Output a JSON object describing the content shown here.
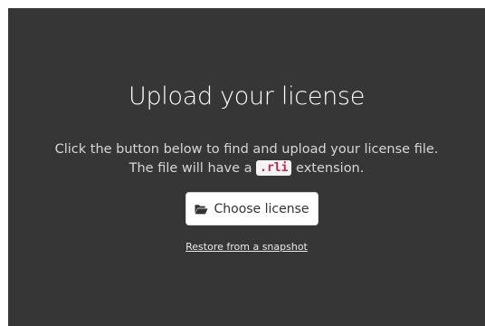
{
  "upload": {
    "title": "Upload your license",
    "description_line1": "Click the button below to find and upload your license file.",
    "description_line2_prefix": "The file will have a ",
    "extension": ".rli",
    "description_line2_suffix": " extension.",
    "choose_button_label": "Choose license",
    "choose_button_icon": "folder-open-icon",
    "restore_link_label": "Restore from a snapshot"
  },
  "colors": {
    "panel_background": "#363636",
    "title_text": "#ffffff",
    "description_text": "#d6d6d6",
    "code_text": "#c7254e",
    "code_background": "#f4f4f4",
    "button_background": "#ffffff"
  }
}
